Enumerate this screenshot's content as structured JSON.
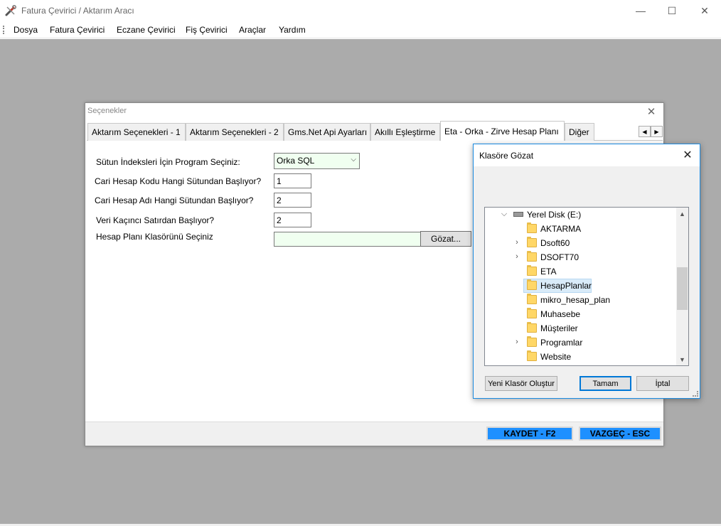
{
  "window": {
    "title": "Fatura Çevirici / Aktarım Aracı",
    "minimize": "—",
    "maximize": "☐",
    "close": "✕"
  },
  "menu": {
    "items": [
      "Dosya",
      "Fatura Çevirici",
      "Eczane Çevirici",
      "Fiş Çevirici",
      "Araçlar",
      "Yardım"
    ]
  },
  "options_dialog": {
    "title": "Seçenekler",
    "close": "✕",
    "tabs": [
      "Aktarım Seçenekleri - 1",
      "Aktarım Seçenekleri - 2",
      "Gms.Net Api Ayarları",
      "Akıllı Eşleştirme",
      "Eta - Orka - Zirve Hesap Planı",
      "Diğer"
    ],
    "active_tab": "Eta - Orka - Zirve Hesap Planı",
    "tab_scroll_left": "◀",
    "tab_scroll_right": "▶",
    "fields": {
      "program_label": "Sütun İndeksleri İçin Program Seçiniz:",
      "program_value": "Orka SQL",
      "code_col_label": "Cari Hesap Kodu Hangi Sütundan Başlıyor?",
      "code_col_value": "1",
      "name_col_label": "Cari Hesap Adı Hangi Sütundan Başlıyor?",
      "name_col_value": "2",
      "start_row_label": "Veri Kaçıncı Satırdan Başlıyor?",
      "start_row_value": "2",
      "folder_label": "Hesap Planı Klasörünü Seçiniz",
      "folder_value": "",
      "browse_label": "Gözat..."
    },
    "save_label": "KAYDET - F2",
    "cancel_label": "VAZGEÇ - ESC",
    "accent_color": "#1e90ff"
  },
  "folder_dialog": {
    "title": "Klasöre Gözat",
    "close": "✕",
    "tree": {
      "drive": "Yerel Disk (E:)",
      "folders": [
        {
          "name": "AKTARMA",
          "expandable": false
        },
        {
          "name": "Dsoft60",
          "expandable": true
        },
        {
          "name": "DSOFT70",
          "expandable": true
        },
        {
          "name": "ETA",
          "expandable": false
        },
        {
          "name": "HesapPlanlar",
          "expandable": false,
          "selected": true
        },
        {
          "name": "mikro_hesap_plan",
          "expandable": false
        },
        {
          "name": "Muhasebe",
          "expandable": false
        },
        {
          "name": "Müşteriler",
          "expandable": false
        },
        {
          "name": "Programlar",
          "expandable": true
        },
        {
          "name": "Website",
          "expandable": false
        }
      ]
    },
    "new_folder_label": "Yeni Klasör Oluştur",
    "ok_label": "Tamam",
    "cancel_label": "İptal"
  }
}
